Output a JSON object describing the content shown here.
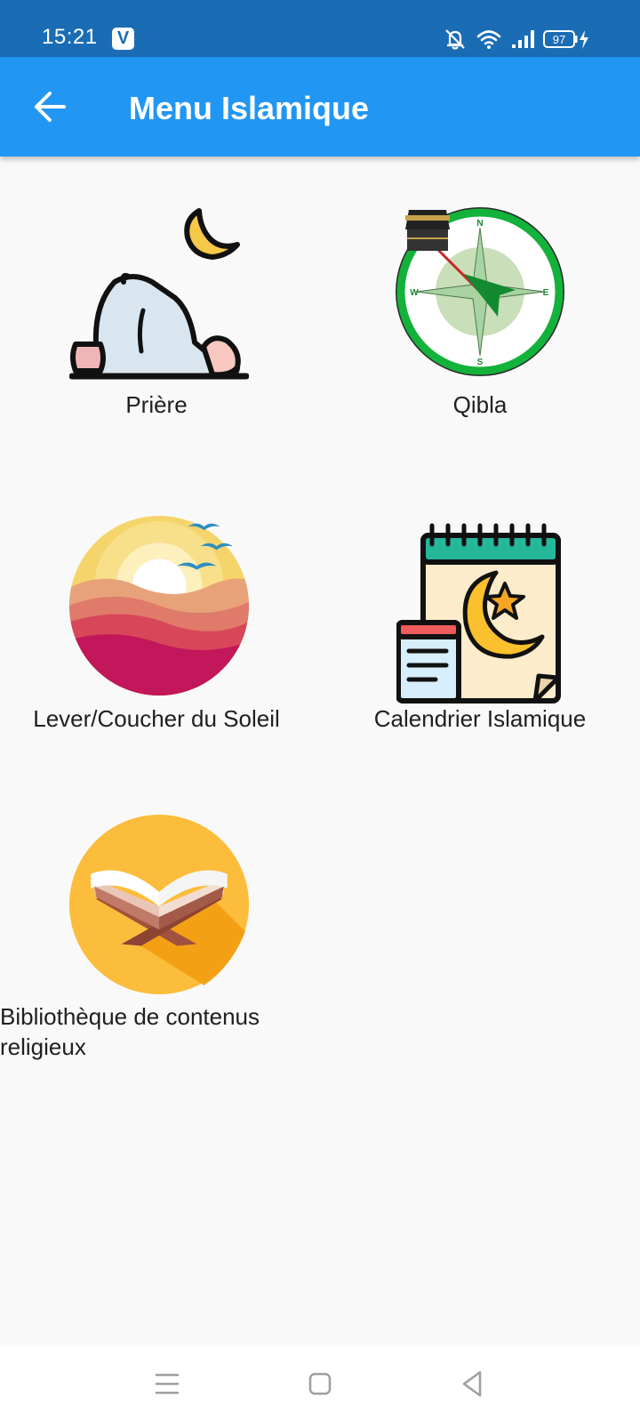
{
  "status_bar": {
    "time": "15:21",
    "app_icon_letter": "V",
    "battery_level": "97"
  },
  "app_bar": {
    "title": "Menu Islamique",
    "color": "#2196f3"
  },
  "menu": {
    "items": [
      {
        "label": "Prière",
        "icon": "prayer-icon"
      },
      {
        "label": "Qibla",
        "icon": "qibla-compass-icon"
      },
      {
        "label": "Lever/Coucher du Soleil",
        "icon": "sunrise-sunset-icon"
      },
      {
        "label": "Calendrier Islamique",
        "icon": "islamic-calendar-icon"
      },
      {
        "label": "Bibliothèque de contenus religieux",
        "icon": "quran-book-icon"
      }
    ]
  },
  "nav_bar": {
    "buttons": [
      "menu-icon",
      "home-icon",
      "back-icon"
    ]
  }
}
